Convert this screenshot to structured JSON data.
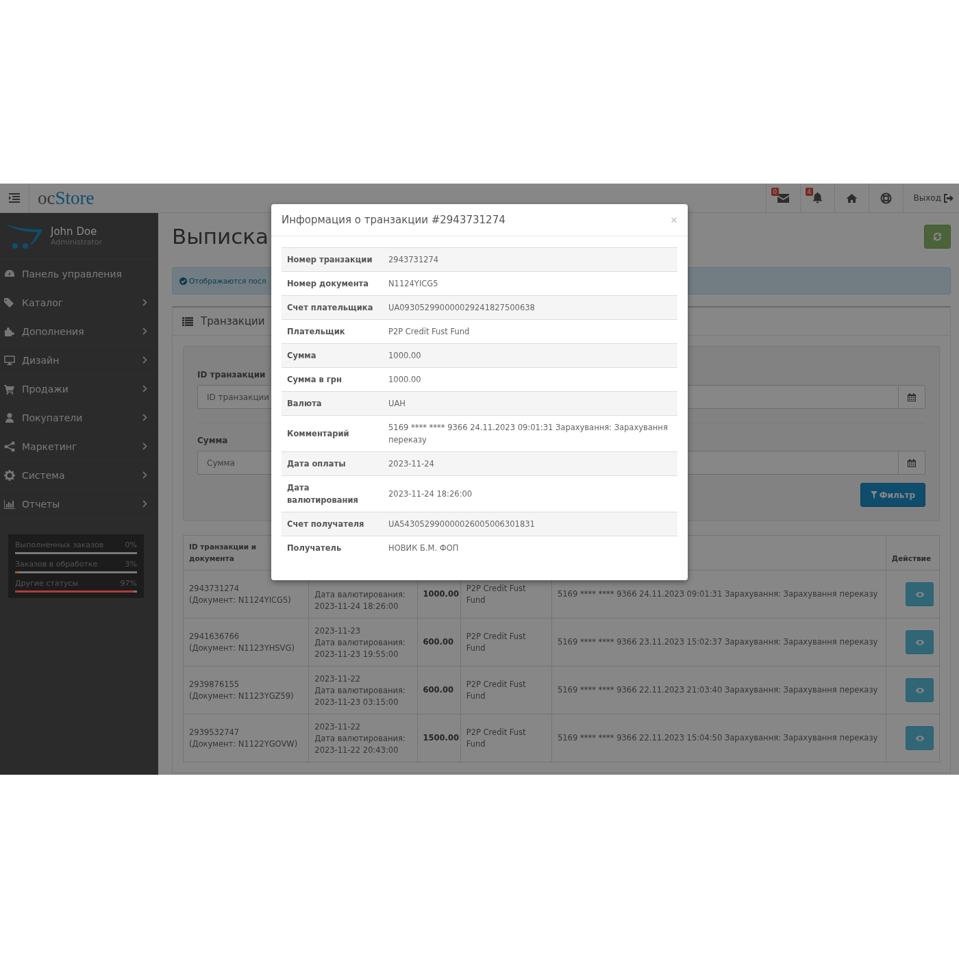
{
  "header": {
    "logo": {
      "prefix": "oc",
      "name": "Store"
    },
    "mail_badge": "0",
    "alert_badge": "4",
    "logout": "Выход"
  },
  "sidebar": {
    "user": {
      "name": "John Doe",
      "role": "Administrator"
    },
    "items": [
      {
        "label": "Панель управления",
        "has_children": false
      },
      {
        "label": "Каталог",
        "has_children": true
      },
      {
        "label": "Дополнения",
        "has_children": true
      },
      {
        "label": "Дизайн",
        "has_children": true
      },
      {
        "label": "Продажи",
        "has_children": true
      },
      {
        "label": "Покупатели",
        "has_children": true
      },
      {
        "label": "Маркетинг",
        "has_children": true
      },
      {
        "label": "Система",
        "has_children": true
      },
      {
        "label": "Отчеты",
        "has_children": true
      }
    ],
    "stats": [
      {
        "label": "Выполненных заказов",
        "value": "0%",
        "level": 0
      },
      {
        "label": "Заказов в обработке",
        "value": "3%",
        "level": 0.03,
        "color": "#a85a26"
      },
      {
        "label": "Другие статусы",
        "value": "97%",
        "level": 0.97,
        "color": "#b03c3c"
      }
    ]
  },
  "page": {
    "title": "Выписка",
    "alert": "Отображаются посл",
    "panel_title": "Транзакции",
    "filters": [
      {
        "kind": "text",
        "label": "ID транзакции",
        "placeholder": "ID транзакции"
      },
      {
        "kind": "date"
      },
      {
        "kind": "text",
        "label": "Сумма",
        "placeholder": "Сумма"
      },
      {
        "kind": "date"
      }
    ],
    "filter_button": "Фильтр"
  },
  "table": {
    "columns": [
      {
        "lines": [
          "ID транзакции и",
          "документа"
        ]
      },
      {},
      {},
      {},
      {},
      {
        "lines": [
          "Действие"
        ]
      }
    ],
    "rows": [
      {
        "id": "2943731274\n(Документ: N1124YICG5)",
        "dates": "Дата валютирования:\n2023-11-24 18:26:00",
        "amount": "1000.00",
        "payer": "P2P Credit Fust Fund",
        "comment": "5169 **** **** 9366 24.11.2023 09:01:31 Зарахування: Зарахування переказу"
      },
      {
        "id": "2941636766\n(Документ: N1123YHSVG)",
        "dates": "2023-11-23\nДата валютирования:\n2023-11-23 19:55:00",
        "amount": "600.00",
        "payer": "P2P Credit Fust Fund",
        "comment": "5169 **** **** 9366 23.11.2023 15:02:37 Зарахування: Зарахування переказу"
      },
      {
        "id": "2939876155\n(Документ: N1123YGZ59)",
        "dates": "2023-11-22\nДата валютирования:\n2023-11-23 03:15:00",
        "amount": "600.00",
        "payer": "P2P Credit Fust Fund",
        "comment": "5169 **** **** 9366 22.11.2023 21:03:40 Зарахування: Зарахування переказу"
      },
      {
        "id": "2939532747\n(Документ: N1122YGOVW)",
        "dates": "2023-11-22\nДата валютирования:\n2023-11-22 20:43:00",
        "amount": "1500.00",
        "payer": "P2P Credit Fust Fund",
        "comment": "5169 **** **** 9366 22.11.2023 15:04:50 Зарахування: Зарахування переказу"
      }
    ]
  },
  "modal": {
    "title": "Информация о транзакции #2943731274",
    "close": "×",
    "rows": [
      {
        "label": "Номер транзакции",
        "value": "2943731274"
      },
      {
        "label": "Номер документа",
        "value": "N1124YICG5"
      },
      {
        "label": "Счет плательщика",
        "value": "UA093052990000029241827500638"
      },
      {
        "label": "Плательщик",
        "value": "P2P Credit Fust Fund"
      },
      {
        "label": "Сумма",
        "value": "1000.00"
      },
      {
        "label": "Сумма в грн",
        "value": "1000.00"
      },
      {
        "label": "Валюта",
        "value": "UAH"
      },
      {
        "label": "Комментарий",
        "value": "5169 **** **** 9366 24.11.2023 09:01:31 Зарахування: Зарахування переказу"
      },
      {
        "label": "Дата оплаты",
        "value": "2023-11-24"
      },
      {
        "label": "Дата валютирования",
        "value": "2023-11-24 18:26:00"
      },
      {
        "label": "Счет получателя",
        "value": "UA543052990000026005006301831"
      },
      {
        "label": "Получатель",
        "value": "НОВИК Б.М. ФОП"
      }
    ]
  }
}
